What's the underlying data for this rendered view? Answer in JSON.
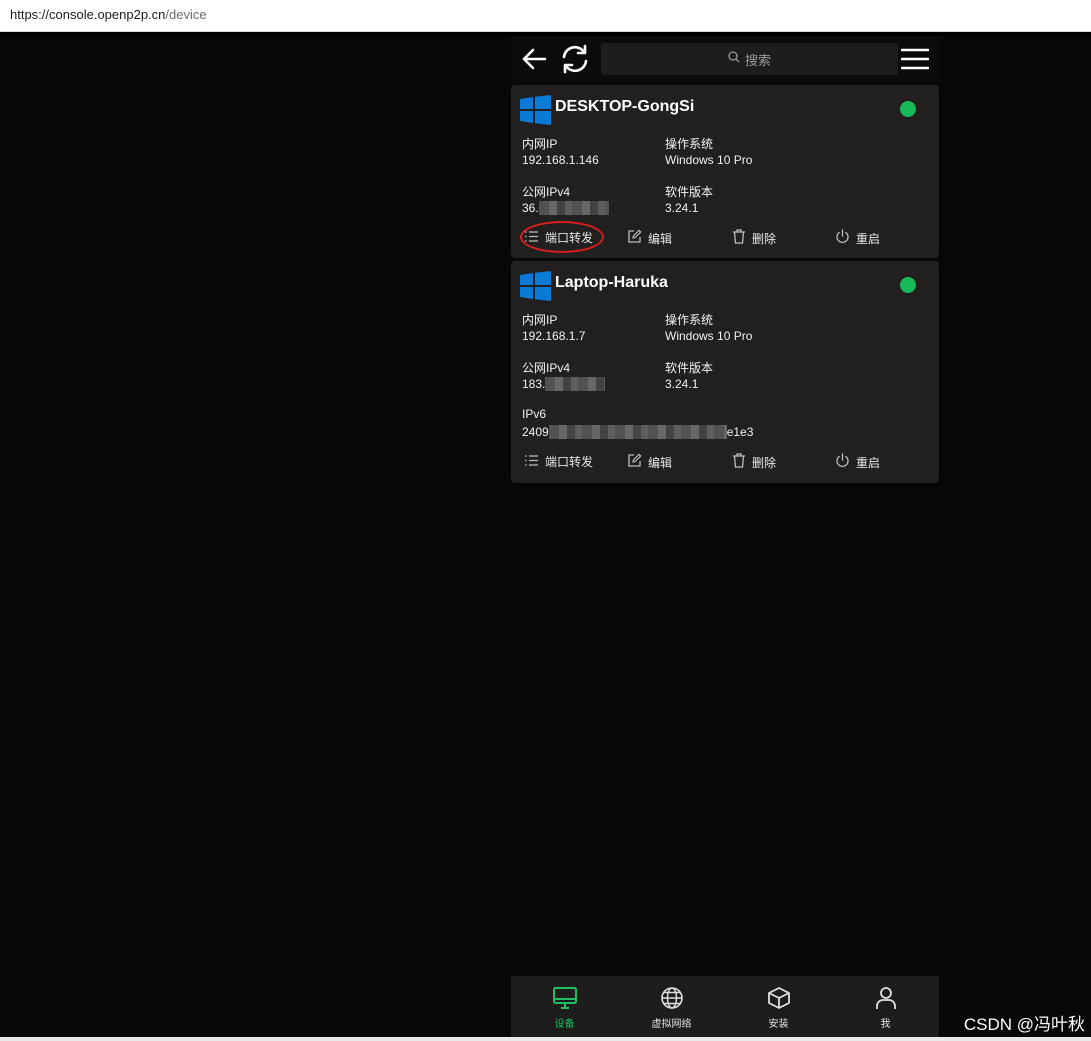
{
  "browser": {
    "url_host": "https://console.openp2p.cn",
    "url_path": "/device"
  },
  "header": {
    "back_icon": "arrow-left-icon",
    "refresh_icon": "refresh-icon",
    "search_placeholder": "搜索",
    "menu_icon": "hamburger-menu-icon"
  },
  "colors": {
    "online": "#18b95a",
    "active_tab": "#1fbf62",
    "card_bg": "#221f1f",
    "annotation_red": "#d81e1e"
  },
  "devices": [
    {
      "name": "DESKTOP-GongSi",
      "status": "online",
      "lan_ip_label": "内网IP",
      "lan_ip": "192.168.1.146",
      "os_label": "操作系统",
      "os": "Windows 10 Pro",
      "wan_label": "公网IPv4",
      "wan_prefix": "36.",
      "version_label": "软件版本",
      "version": "3.24.1"
    },
    {
      "name": "Laptop-Haruka",
      "status": "online",
      "lan_ip_label": "内网IP",
      "lan_ip": "192.168.1.7",
      "os_label": "操作系统",
      "os": "Windows 10 Pro",
      "wan_label": "公网IPv4",
      "wan_prefix": "183.",
      "version_label": "软件版本",
      "version": "3.24.1",
      "ipv6_label": "IPv6",
      "ipv6_prefix": "2409",
      "ipv6_suffix": "e1e3"
    }
  ],
  "actions": {
    "port_forward": "端口转发",
    "edit": "编辑",
    "delete": "删除",
    "restart": "重启"
  },
  "tabs": [
    {
      "label": "设备",
      "icon": "monitor-icon",
      "active": true
    },
    {
      "label": "虚拟网络",
      "icon": "globe-icon",
      "active": false
    },
    {
      "label": "安装",
      "icon": "box-icon",
      "active": false
    },
    {
      "label": "我",
      "icon": "user-icon",
      "active": false
    }
  ],
  "watermark": "CSDN @冯叶秋"
}
